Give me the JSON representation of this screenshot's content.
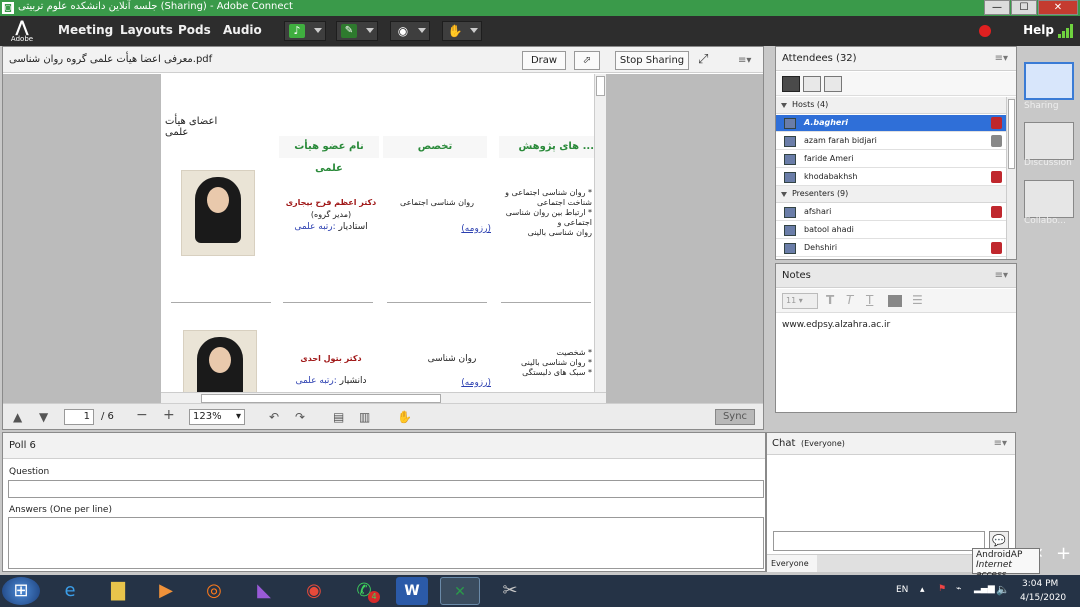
{
  "window": {
    "title": "جلسه آنلاین دانشکده علوم تربیتی (Sharing) - Adobe Connect",
    "min": "—",
    "max": "☐",
    "close": "✕"
  },
  "menubar": {
    "logo_text": "Adobe",
    "items": [
      "Meeting",
      "Layouts",
      "Pods",
      "Audio"
    ],
    "help": "Help"
  },
  "share_pod": {
    "title": "معرفی اعضا هیأت علمی گروه روان شناسی.pdf",
    "draw_label": "Draw",
    "stop_sharing_label": "Stop Sharing",
    "page_current": "1",
    "page_total": "/ 6",
    "zoom": "123%",
    "sync_label": "Sync",
    "doc": {
      "heading": "اعضای هیأت علمی",
      "headers": [
        "نام عضو هیأت علمی",
        "تخصص",
        "... های پژوهش"
      ],
      "rows": [
        {
          "name": "دکتر اعظم فرح بیجاری",
          "role": "(مدیر گروه)",
          "rank_label": "استادیار",
          "rank_link": ":رتبه علمی",
          "specialty": "روان شناسی اجتماعی",
          "resume": "(رزومه)",
          "research": [
            "* روان شناسی اجتماعی و",
            "شناخت اجتماعی",
            "* ارتباط بین روان شناسی",
            "اجتماعی و",
            "روان شناسی بالینی"
          ]
        },
        {
          "name": "دکتر بتول احدی",
          "rank_label": "دانشیار",
          "rank_link": ":رتبه علمی",
          "specialty": "روان شناسی",
          "resume": "(رزومه)",
          "research": [
            "* شخصیت",
            "* روان شناسی بالینی",
            "* سبک های دلبستگی"
          ]
        }
      ]
    }
  },
  "attendees": {
    "title": "Attendees",
    "count": "(32)",
    "groups": [
      {
        "label": "Hosts (4)",
        "people": [
          "A.bagheri",
          "azam farah bidjari",
          "faride Ameri",
          "khodabakhsh"
        ]
      },
      {
        "label": "Presenters (9)",
        "people": [
          "afshari",
          "batool ahadi",
          "Dehshiri"
        ]
      }
    ]
  },
  "notes": {
    "title": "Notes",
    "font_size": "11",
    "content": "www.edpsy.alzahra.ac.ir"
  },
  "layouts": [
    "Sharing",
    "Discussion",
    "Collabo..."
  ],
  "poll": {
    "title": "Poll 6",
    "question_label": "Question",
    "answers_label": "Answers (One per line)"
  },
  "chat": {
    "title": "Chat",
    "scope": "(Everyone)",
    "target": "Everyone"
  },
  "tooltip": {
    "line1": "AndroidAP",
    "line2": "Internet access"
  },
  "taskbar": {
    "lang": "EN",
    "time": "3:04 PM",
    "date": "4/15/2020",
    "whatsapp_badge": "4"
  },
  "colors": {
    "title_green": "#3a9a4a",
    "menubar": "#2d2d2d",
    "selected_blue": "#2f6fd8",
    "header_green": "#2a8a3a",
    "name_red": "#a01818",
    "link_blue": "#2b3fb0"
  }
}
